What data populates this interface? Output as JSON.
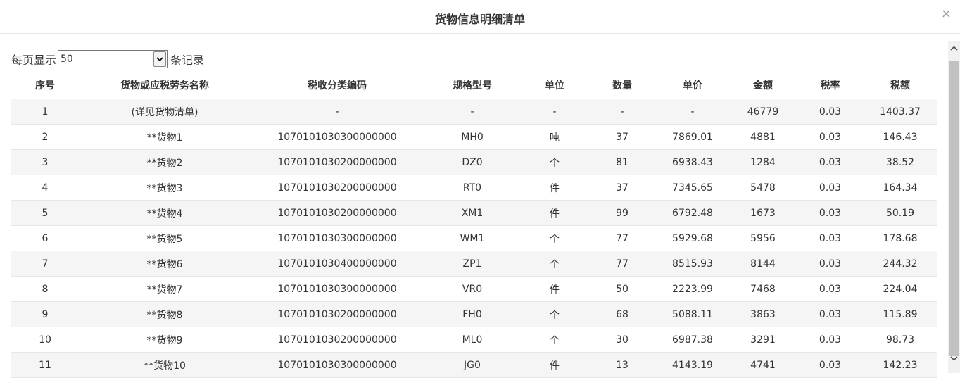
{
  "dialog": {
    "title": "货物信息明细清单",
    "close_label": "×"
  },
  "pager": {
    "prefix": "每页显示",
    "page_size": "50",
    "suffix": "条记录"
  },
  "table": {
    "headers": [
      "序号",
      "货物或应税劳务名称",
      "税收分类编码",
      "规格型号",
      "单位",
      "数量",
      "单价",
      "金额",
      "税率",
      "税额"
    ],
    "rows": [
      [
        "1",
        "(详见货物清单)",
        "-",
        "-",
        "-",
        "-",
        "-",
        "46779",
        "0.03",
        "1403.37"
      ],
      [
        "2",
        "**货物1",
        "1070101030300000000",
        "MH0",
        "吨",
        "37",
        "7869.01",
        "4881",
        "0.03",
        "146.43"
      ],
      [
        "3",
        "**货物2",
        "1070101030200000000",
        "DZ0",
        "个",
        "81",
        "6938.43",
        "1284",
        "0.03",
        "38.52"
      ],
      [
        "4",
        "**货物3",
        "1070101030200000000",
        "RT0",
        "件",
        "37",
        "7345.65",
        "5478",
        "0.03",
        "164.34"
      ],
      [
        "5",
        "**货物4",
        "1070101030200000000",
        "XM1",
        "件",
        "99",
        "6792.48",
        "1673",
        "0.03",
        "50.19"
      ],
      [
        "6",
        "**货物5",
        "1070101030300000000",
        "WM1",
        "个",
        "77",
        "5929.68",
        "5956",
        "0.03",
        "178.68"
      ],
      [
        "7",
        "**货物6",
        "1070101030400000000",
        "ZP1",
        "个",
        "77",
        "8515.93",
        "8144",
        "0.03",
        "244.32"
      ],
      [
        "8",
        "**货物7",
        "1070101030300000000",
        "VR0",
        "件",
        "50",
        "2223.99",
        "7468",
        "0.03",
        "224.04"
      ],
      [
        "9",
        "**货物8",
        "1070101030200000000",
        "FH0",
        "个",
        "68",
        "5088.11",
        "3863",
        "0.03",
        "115.89"
      ],
      [
        "10",
        "**货物9",
        "1070101030200000000",
        "ML0",
        "个",
        "30",
        "6987.38",
        "3291",
        "0.03",
        "98.73"
      ],
      [
        "11",
        "**货物10",
        "1070101030300000000",
        "JG0",
        "件",
        "13",
        "4143.19",
        "4741",
        "0.03",
        "142.23"
      ]
    ]
  },
  "icons": {
    "close": "close-icon",
    "dropdown": "chevron-down-icon",
    "scroll_up": "chevron-up-icon",
    "scroll_down": "chevron-down-icon"
  }
}
